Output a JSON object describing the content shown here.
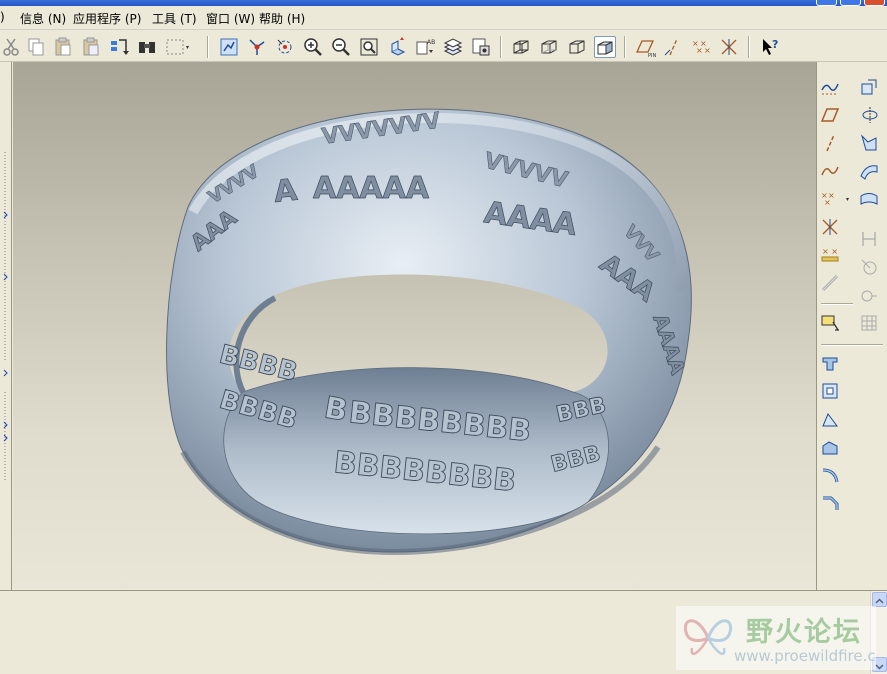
{
  "menu": {
    "items": [
      {
        "label": ")"
      },
      {
        "label": "信息 (N)"
      },
      {
        "label": "应用程序 (P)"
      },
      {
        "label": "工具 (T)"
      },
      {
        "label": "窗口 (W)"
      },
      {
        "label": "帮助 (H)"
      }
    ]
  },
  "toolbar": {
    "icons": [
      "cut-icon",
      "copy-icon",
      "paste-icon",
      "paste-special-icon",
      "regenerate-icon",
      "find-icon",
      "select-box-icon",
      "view-mode-icon",
      "datum-point-icon",
      "spin-center-icon",
      "zoom-in-icon",
      "zoom-out-icon",
      "refit-icon",
      "reorient-icon",
      "saved-views-icon",
      "layers-icon",
      "model-display-icon",
      "wireframe-icon",
      "hidden-line-icon",
      "no-hidden-icon",
      "shading-icon",
      "datum-planes-icon",
      "datum-axes-icon",
      "datum-points-icon",
      "coordinate-systems-icon",
      "context-help-icon"
    ],
    "active": "shading-icon"
  },
  "right_toolbar": {
    "icons": [
      "sketch-curve-icon",
      "plane-icon",
      "axis-icon",
      "curve-icon",
      "point-icon",
      "csys-icon",
      "analysis-icon",
      "chain-icon",
      "sketch-tool-icon",
      "extrude-icon",
      "revolve-icon",
      "sweep-icon",
      "blend-icon",
      "hole-icon",
      "shell-icon",
      "rib-icon",
      "draft-icon",
      "round-icon",
      "chamfer-icon",
      "pattern-icon",
      "mirror-icon",
      "merge-icon",
      "trim-icon",
      "table-icon"
    ]
  },
  "viewport": {
    "model": "ring-with-engraved-text",
    "outer_pattern_letter": "A",
    "inner_pattern_letter": "B"
  },
  "watermark": {
    "title": "野火论坛",
    "url": "www.proewildfire.c"
  },
  "colors": {
    "model": "#a9b7c6",
    "viewport_top": "#a8a496",
    "viewport_bottom": "#e9e5d7",
    "chrome": "#ece9d8"
  }
}
